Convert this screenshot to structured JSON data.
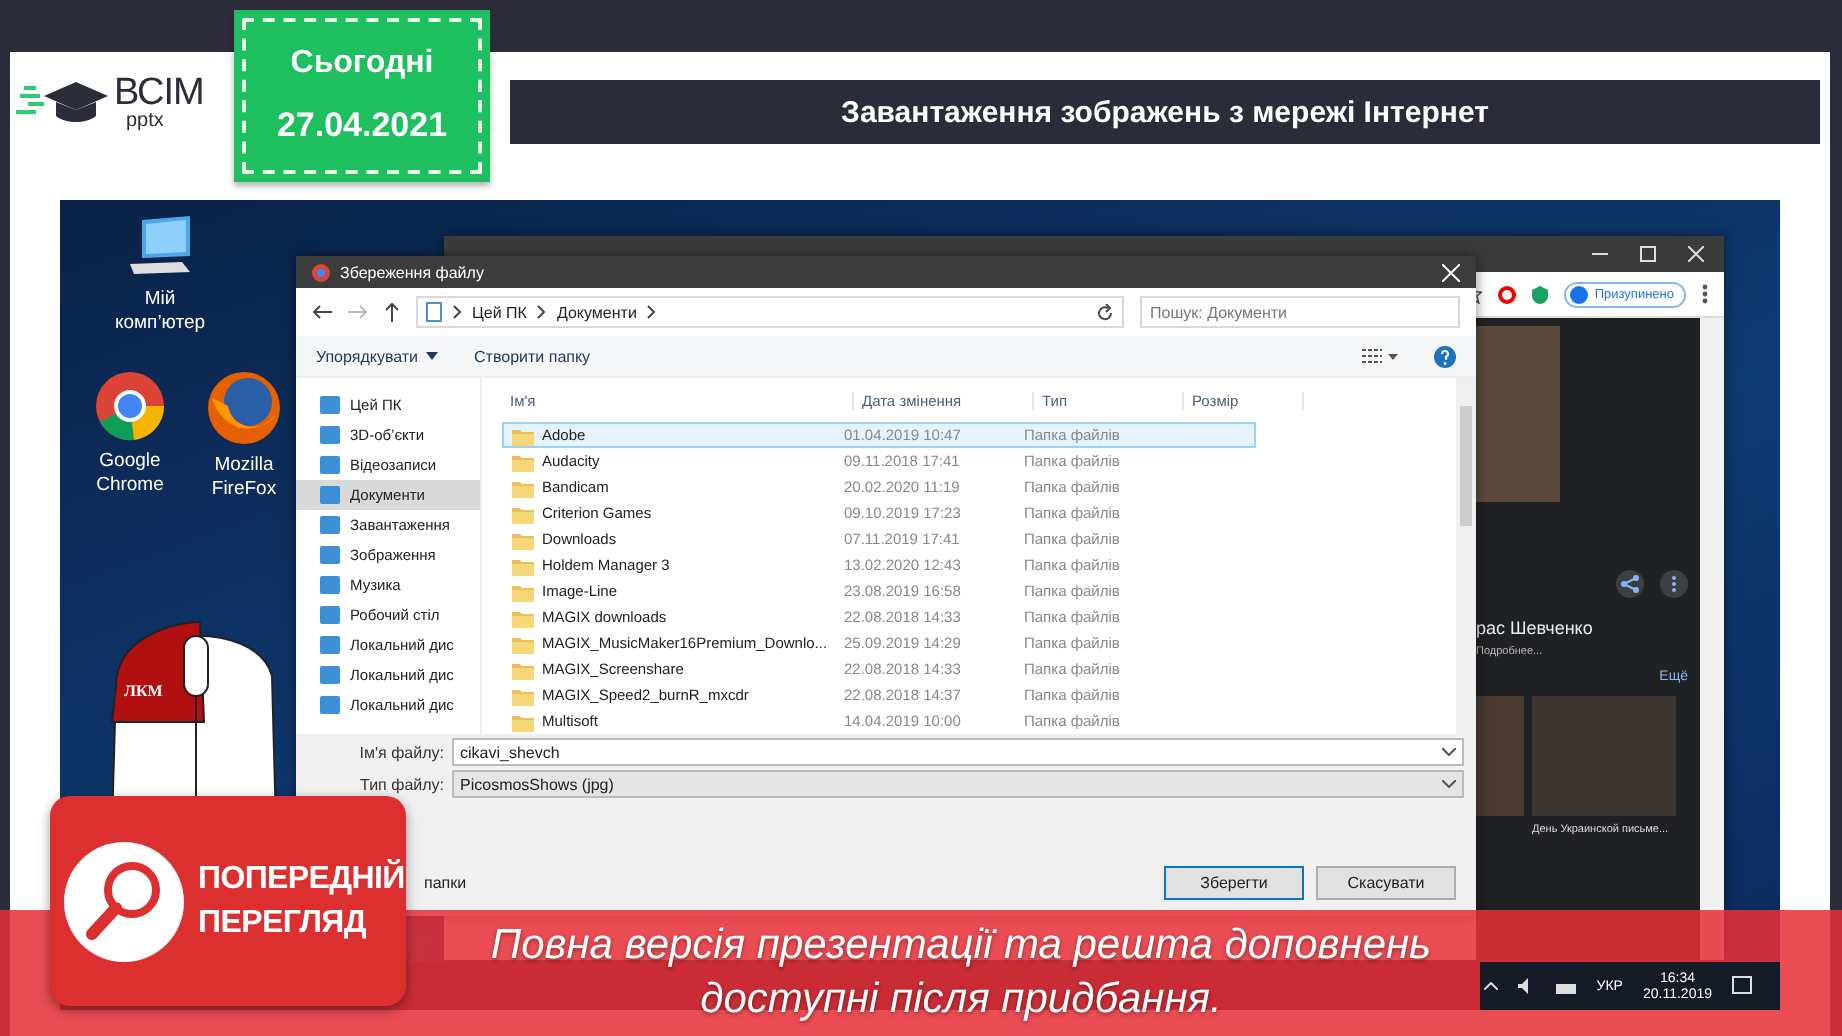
{
  "logo": {
    "name": "ВСІМ",
    "sub": "pptx"
  },
  "date_badge": {
    "label": "Сьогодні",
    "date": "27.04.2021"
  },
  "title": "Завантаження зображень з мережі Інтернет",
  "desktop": {
    "icons": [
      {
        "kind": "computer",
        "label": "Мій\nкомп’ютер"
      },
      {
        "kind": "chrome",
        "label": "Google\nChrome"
      },
      {
        "kind": "firefox",
        "label": "Mozilla\nFireFox"
      }
    ],
    "mouse_label": "ЛКМ",
    "browser": {
      "profile": "Призупинено",
      "heading": "рас Шевченко",
      "details_link": "Подробнее...",
      "more_link": "Ещё",
      "caption": "День Украинской письме..."
    },
    "dialog": {
      "title": "Збереження файлу",
      "path": [
        "Цей ПК",
        "Документи"
      ],
      "search": {
        "placeholder": "Пошук: Документи"
      },
      "toolbar": [
        "Упорядкувати",
        "Створити папку"
      ],
      "nav": [
        {
          "label": "Цей ПК",
          "selected": false
        },
        {
          "label": "3D-об’єкти",
          "selected": false
        },
        {
          "label": "Відеозаписи",
          "selected": false
        },
        {
          "label": "Документи",
          "selected": true
        },
        {
          "label": "Завантаження",
          "selected": false
        },
        {
          "label": "Зображення",
          "selected": false
        },
        {
          "label": "Музика",
          "selected": false
        },
        {
          "label": "Робочий стіл",
          "selected": false
        },
        {
          "label": "Локальний дис",
          "selected": false
        },
        {
          "label": "Локальний дис",
          "selected": false
        },
        {
          "label": "Локальний дис",
          "selected": false
        }
      ],
      "columns": [
        "Ім'я",
        "Дата змінення",
        "Тип",
        "Розмір"
      ],
      "files": [
        {
          "name": "Adobe",
          "date": "01.04.2019 10:47",
          "type": "Папка файлів",
          "selected": true
        },
        {
          "name": "Audacity",
          "date": "09.11.2018 17:41",
          "type": "Папка файлів",
          "selected": false
        },
        {
          "name": "Bandicam",
          "date": "20.02.2020 11:19",
          "type": "Папка файлів",
          "selected": false
        },
        {
          "name": "Criterion Games",
          "date": "09.10.2019 17:23",
          "type": "Папка файлів",
          "selected": false
        },
        {
          "name": "Downloads",
          "date": "07.11.2019 17:41",
          "type": "Папка файлів",
          "selected": false
        },
        {
          "name": "Holdem Manager 3",
          "date": "13.02.2020 12:43",
          "type": "Папка файлів",
          "selected": false
        },
        {
          "name": "Image-Line",
          "date": "23.08.2019 16:58",
          "type": "Папка файлів",
          "selected": false
        },
        {
          "name": "MAGIX downloads",
          "date": "22.08.2018 14:33",
          "type": "Папка файлів",
          "selected": false
        },
        {
          "name": "MAGIX_MusicMaker16Premium_Downlo...",
          "date": "25.09.2019 14:29",
          "type": "Папка файлів",
          "selected": false
        },
        {
          "name": "MAGIX_Screenshare",
          "date": "22.08.2018 14:33",
          "type": "Папка файлів",
          "selected": false
        },
        {
          "name": "MAGIX_Speed2_burnR_mxcdr",
          "date": "22.08.2018 14:37",
          "type": "Папка файлів",
          "selected": false
        },
        {
          "name": "Multisoft",
          "date": "14.04.2019 10:00",
          "type": "Папка файлів",
          "selected": false
        }
      ],
      "filename": {
        "label": "Ім'я файлу:",
        "value": "cikavi_shevch"
      },
      "filetype": {
        "label": "Тип файлу:",
        "value": "PicosmosShows (jpg)"
      },
      "hide_folders": "папки",
      "buttons": [
        "Зберегти",
        "Скасувати"
      ]
    },
    "taskbar": {
      "language": "УКР",
      "time": "16:34",
      "date": "20.11.2019"
    }
  },
  "preview": {
    "badge": [
      "ПОПЕРЕДНІЙ",
      "ПЕРЕГЛЯД"
    ],
    "message": "Повна версія презентації та решта доповнень\nдоступні після придбання."
  }
}
